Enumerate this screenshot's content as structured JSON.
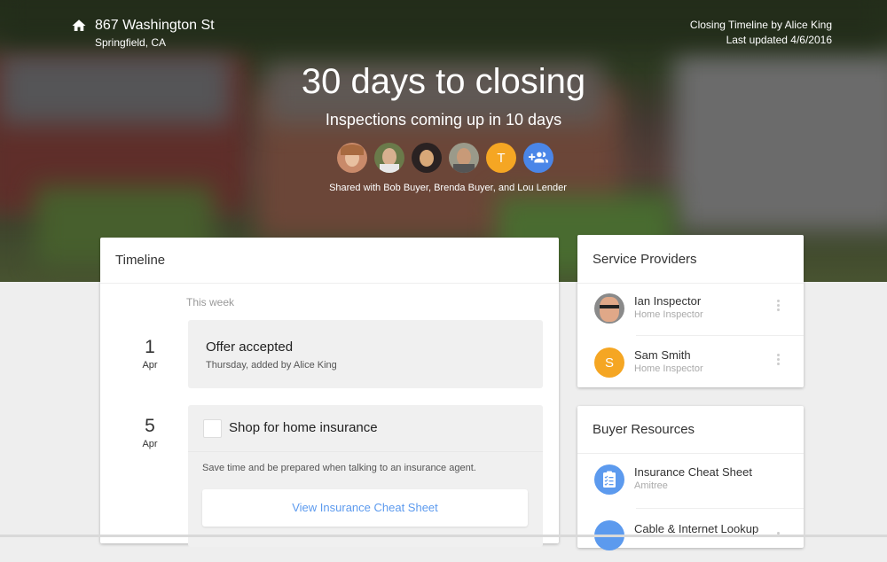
{
  "header": {
    "address_line1": "867 Washington St",
    "address_line2": "Springfield, CA",
    "timeline_by": "Closing Timeline by Alice King",
    "last_updated": "Last updated 4/6/2016",
    "title": "30 days to closing",
    "subtitle": "Inspections coming up in 10 days",
    "avatars": [
      {
        "type": "photo",
        "color": "#c98a6a"
      },
      {
        "type": "photo",
        "color": "#b89070"
      },
      {
        "type": "photo",
        "color": "#8a5a40"
      },
      {
        "type": "photo",
        "color": "#9a7a66"
      },
      {
        "type": "initial",
        "initial": "T",
        "color": "#f5a623"
      },
      {
        "type": "add-people",
        "color": "#4a86e8"
      }
    ],
    "shared_text": "Shared with Bob Buyer, Brenda Buyer, and Lou Lender"
  },
  "timeline": {
    "title": "Timeline",
    "section_label": "This week",
    "events": [
      {
        "day": "1",
        "month": "Apr",
        "title": "Offer accepted",
        "subtitle": "Thursday, added by Alice King"
      },
      {
        "day": "5",
        "month": "Apr",
        "title": "Shop for home insurance",
        "checked": false,
        "description": "Save time and be prepared when talking to an insurance agent.",
        "button_label": "View Insurance Cheat Sheet"
      }
    ]
  },
  "providers": {
    "title": "Service Providers",
    "items": [
      {
        "name": "Ian Inspector",
        "role": "Home Inspector",
        "avatar": "photo"
      },
      {
        "name": "Sam Smith",
        "role": "Home Inspector",
        "avatar": "initial",
        "initial": "S",
        "color": "#f5a623"
      }
    ]
  },
  "resources": {
    "title": "Buyer Resources",
    "items": [
      {
        "name": "Insurance Cheat Sheet",
        "source": "Amitree",
        "icon": "clipboard-checklist-icon",
        "color": "#5c9aee"
      },
      {
        "name": "Cable & Internet Lookup",
        "source": "",
        "icon": "wifi-icon",
        "color": "#5c9aee"
      }
    ]
  },
  "colors": {
    "accent": "#5c9aee",
    "orange": "#f5a623",
    "blue": "#4a86e8"
  }
}
